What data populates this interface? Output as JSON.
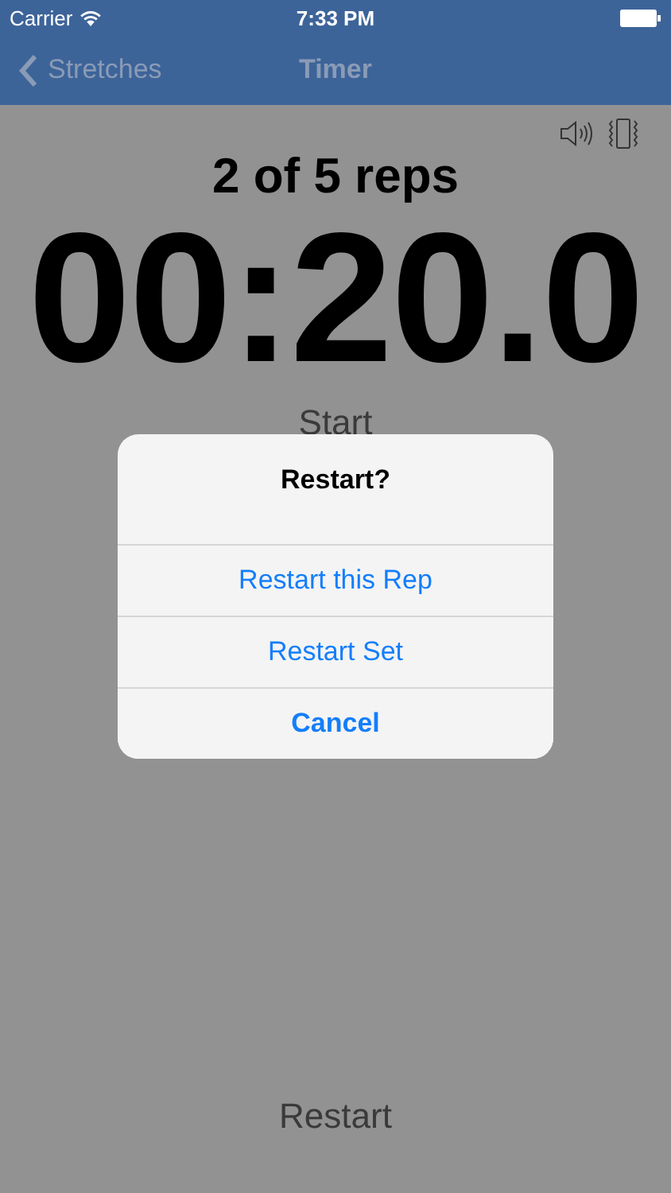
{
  "status_bar": {
    "carrier": "Carrier",
    "time": "7:33 PM"
  },
  "nav": {
    "back": "Stretches",
    "title": "Timer"
  },
  "toggles": {
    "sound": true,
    "vibrate": true
  },
  "reps": "2 of 5 reps",
  "timer": "00:20.0",
  "start_button": "Start",
  "restart_button": "Restart",
  "alert": {
    "title": "Restart?",
    "actions": [
      {
        "label": "Restart this Rep",
        "kind": "default"
      },
      {
        "label": "Restart Set",
        "kind": "default"
      },
      {
        "label": "Cancel",
        "kind": "cancel"
      }
    ]
  }
}
